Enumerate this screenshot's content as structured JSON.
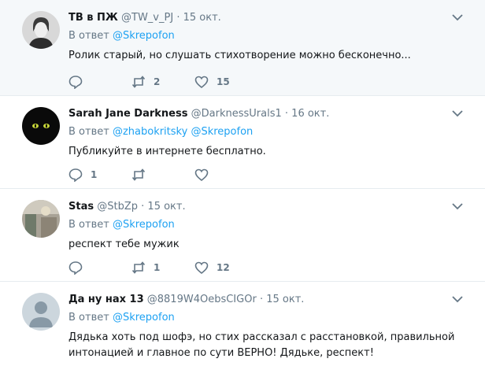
{
  "reply_prefix": "В ответ",
  "tweets": [
    {
      "name": "ТВ в ПЖ",
      "handle": "@TW_v_PJ",
      "separator": "·",
      "time": "15 окт.",
      "mentions": [
        "@Skrepofon"
      ],
      "text": "Ролик старый, но слушать стихотворение можно бесконечно...",
      "replies": "",
      "retweets": "2",
      "likes": "15",
      "avatar_color": "#b9b9b9"
    },
    {
      "name": "Sarah Jane Darkness",
      "handle": "@DarknessUrals1",
      "separator": "·",
      "time": "16 окт.",
      "mentions": [
        "@zhabokritsky",
        "@Skrepofon"
      ],
      "text": "Публикуйте в интернете бесплатно.",
      "replies": "1",
      "retweets": "",
      "likes": "",
      "avatar_color": "#0b0b0b"
    },
    {
      "name": "Stas",
      "handle": "@StbZp",
      "separator": "·",
      "time": "15 окт.",
      "mentions": [
        "@Skrepofon"
      ],
      "text": "респект тебе мужик",
      "replies": "",
      "retweets": "1",
      "likes": "12",
      "avatar_color": "#8a8f8a"
    },
    {
      "name": "Да ну нах 13",
      "handle": "@8819W4OebsCIGOr",
      "separator": "·",
      "time": "15 окт.",
      "mentions": [
        "@Skrepofon"
      ],
      "text": "Дядька хоть под шофэ, но стих рассказал с расстановкой, правильной интонацией и главное по сути ВЕРНО! Дядьке, респект!",
      "replies": "",
      "retweets": "",
      "likes": "",
      "avatar_color": "#ccd6dd"
    }
  ],
  "colors": {
    "link": "#1da1f2",
    "secondary": "#657786",
    "highlight_bg": "#f5f8fa",
    "border": "#e6ecf0"
  },
  "icons": [
    "reply-icon",
    "retweet-icon",
    "like-icon",
    "chevron-down-icon"
  ]
}
